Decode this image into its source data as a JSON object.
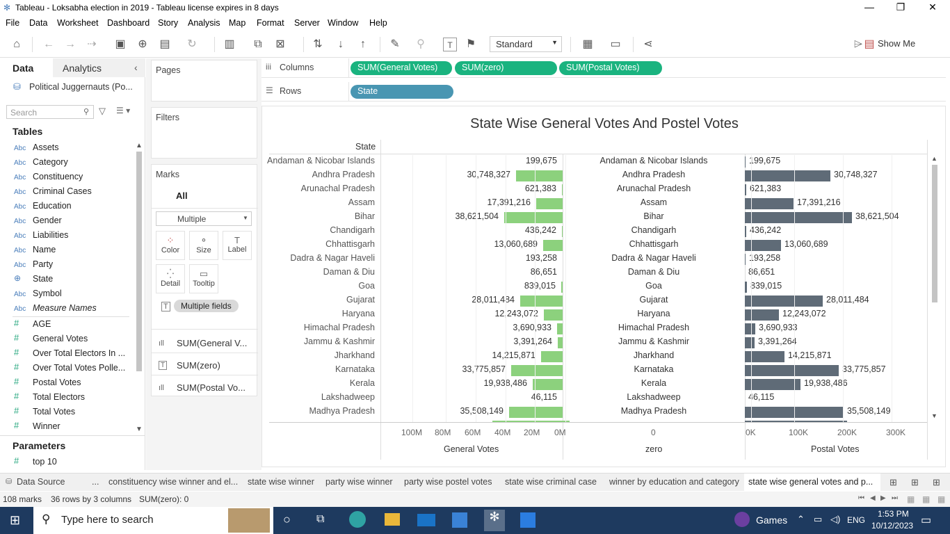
{
  "window": {
    "title": "Tableau - Loksabha election in 2019 - Tableau license expires in 8 days"
  },
  "menu": [
    "File",
    "Data",
    "Worksheet",
    "Dashboard",
    "Story",
    "Analysis",
    "Map",
    "Format",
    "Server",
    "Window",
    "Help"
  ],
  "toolbar": {
    "fit": "Standard",
    "show_me": "Show Me"
  },
  "left": {
    "tab_data": "Data",
    "tab_analytics": "Analytics",
    "datasource": "Political Juggernauts (Po...",
    "search_placeholder": "Search",
    "tables_heading": "Tables",
    "dimensions": [
      "Assets",
      "Category",
      "Constituency",
      "Criminal Cases",
      "Education",
      "Gender",
      "Liabilities",
      "Name",
      "Party",
      "State",
      "Symbol",
      "Measure Names"
    ],
    "measures": [
      "AGE",
      "General Votes",
      "Over Total Electors  In ...",
      "Over Total Votes Polle...",
      "Postal Votes",
      "Total Electors",
      "Total Votes",
      "Winner"
    ],
    "parameters_heading": "Parameters",
    "parameters": [
      "top 10"
    ]
  },
  "cards": {
    "pages": "Pages",
    "filters": "Filters",
    "marks": "Marks",
    "all": "All",
    "mark_type": "Multiple",
    "buttons": [
      "Color",
      "Size",
      "Label",
      "Detail",
      "Tooltip"
    ],
    "multiple_fields": "Multiple fields",
    "mark_rows": [
      "SUM(General V...",
      "SUM(zero)",
      "SUM(Postal Vo..."
    ]
  },
  "shelves": {
    "columns_label": "Columns",
    "rows_label": "Rows",
    "columns": [
      "SUM(General Votes)",
      "SUM(zero)",
      "SUM(Postal Votes)"
    ],
    "rows": [
      "State"
    ]
  },
  "chart_data": {
    "type": "bar",
    "title": "State Wise General Votes And Postel Votes",
    "row_header": "State",
    "categories": [
      "Andaman & Nicobar Islands",
      "Andhra Pradesh",
      "Arunachal Pradesh",
      "Assam",
      "Bihar",
      "Chandigarh",
      "Chhattisgarh",
      "Dadra & Nagar Haveli",
      "Daman & Diu",
      "Goa",
      "Gujarat",
      "Haryana",
      "Himachal Pradesh",
      "Jammu & Kashmir",
      "Jharkhand",
      "Karnataka",
      "Kerala",
      "Lakshadweep",
      "Madhya Pradesh"
    ],
    "general_labels": [
      "199,675",
      "30,748,327",
      "621,383",
      "17,391,216",
      "38,621,504",
      "436,242",
      "13,060,689",
      "193,258",
      "86,651",
      "839,015",
      "28,011,484",
      "12,243,072",
      "3,690,933",
      "3,391,264",
      "14,215,871",
      "33,775,857",
      "19,938,486",
      "46,115",
      "35,508,149"
    ],
    "general_values": [
      199675,
      30748327,
      621383,
      17391216,
      38621504,
      436242,
      13060689,
      193258,
      86651,
      839015,
      28011484,
      12243072,
      3690933,
      3391264,
      14215871,
      33775857,
      19938486,
      46115,
      35508149
    ],
    "postal_labels": [
      "199,675",
      "30,748,327",
      "621,383",
      "17,391,216",
      "38,621,504",
      "436,242",
      "13,060,689",
      "193,258",
      "86,651",
      "839,015",
      "28,011,484",
      "12,243,072",
      "3,690,933",
      "3,391,264",
      "14,215,871",
      "33,775,857",
      "19,938,486",
      "46,115",
      "35,508,149"
    ],
    "general_axis": {
      "title": "General Votes",
      "ticks": [
        "100M",
        "80M",
        "60M",
        "40M",
        "20M",
        "0M"
      ]
    },
    "zero_axis": {
      "title": "zero",
      "ticks": [
        "0"
      ]
    },
    "postal_axis": {
      "title": "Postal Votes",
      "ticks": [
        "0K",
        "100K",
        "200K",
        "300K"
      ]
    },
    "colors": {
      "general": "#8cd17d",
      "postal": "#5f6b77"
    }
  },
  "sheets": [
    "Data Source",
    "...",
    "constituency wise winner and el...",
    "state wise winner",
    "party wise winner",
    "party wise postel votes",
    "state wise criminal case",
    "winner by education and category",
    "state wise general votes and p..."
  ],
  "status": {
    "marks": "108 marks",
    "dims": "36 rows by 3 columns",
    "sum": "SUM(zero): 0"
  },
  "taskbar": {
    "search": "Type here to search",
    "games": "Games",
    "lang": "ENG",
    "time": "1:53 PM",
    "date": "10/12/2023"
  }
}
